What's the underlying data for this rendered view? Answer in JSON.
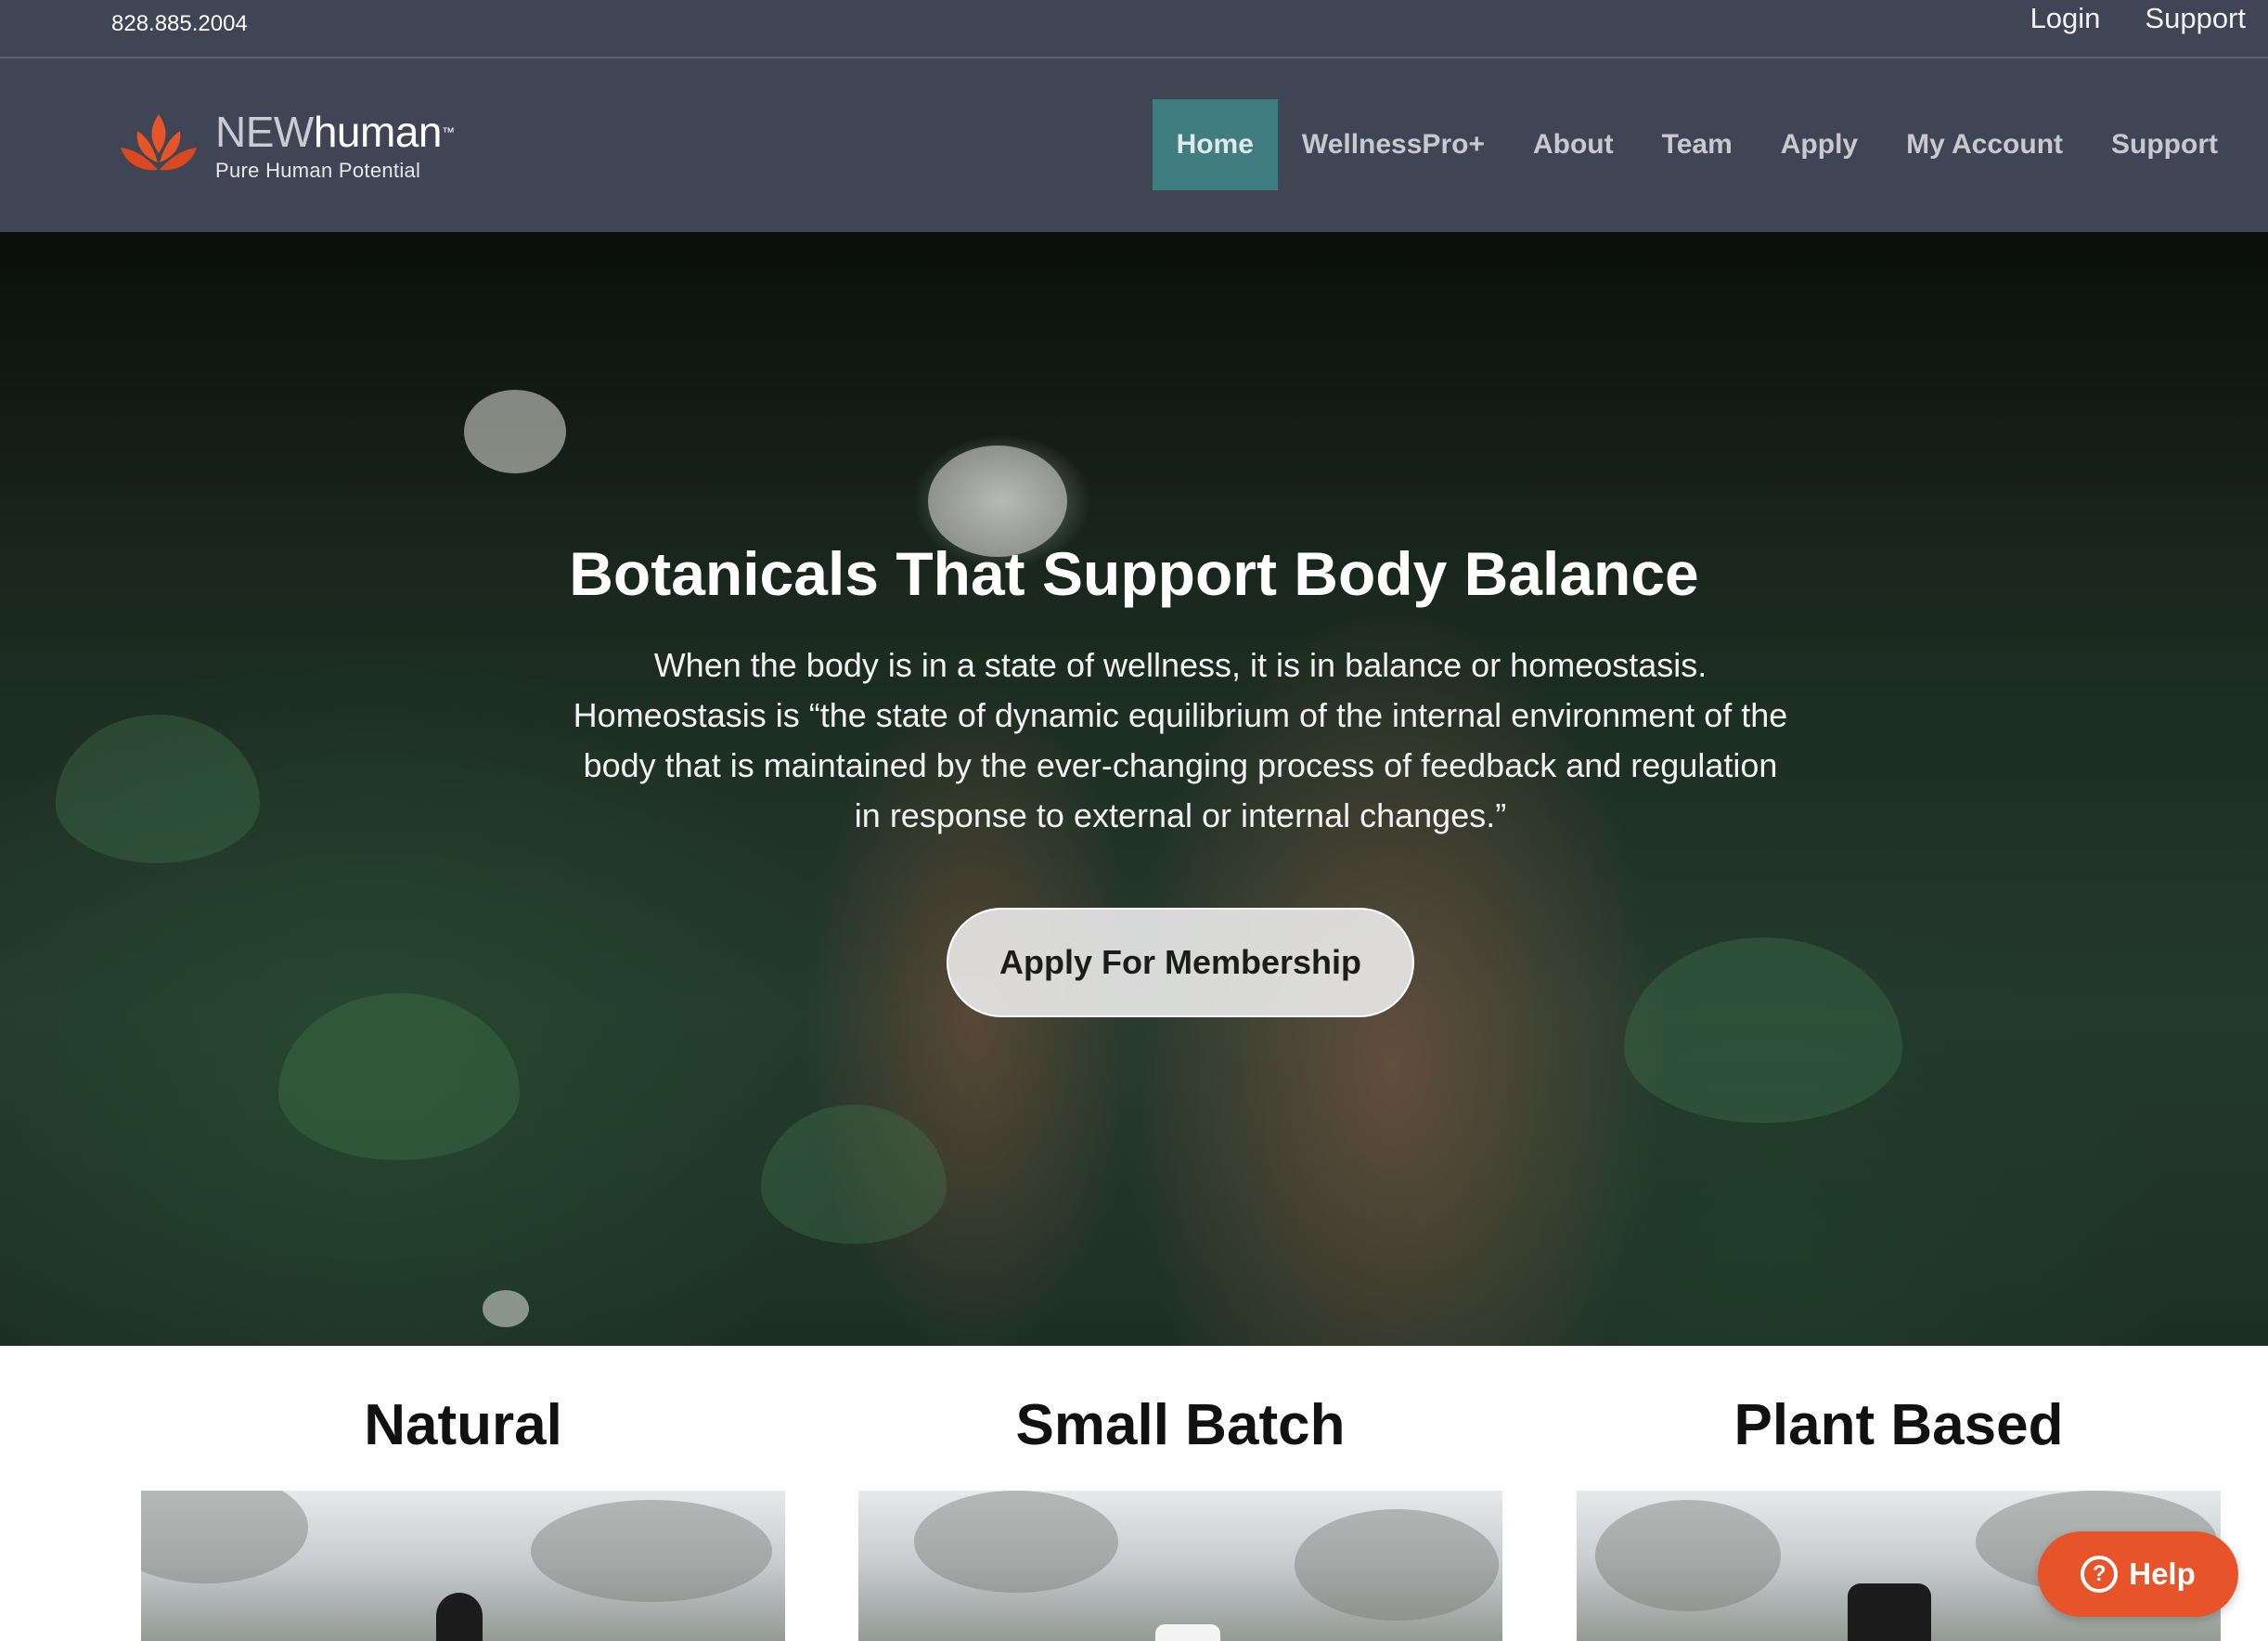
{
  "topbar": {
    "phone": "828.885.2004",
    "login": "Login",
    "support": "Support"
  },
  "logo": {
    "brand_prefix": "NEW",
    "brand_suffix": "human",
    "trademark": "™",
    "tagline": "Pure Human Potential",
    "icon": "lotus-icon",
    "accent_color": "#e8542a"
  },
  "nav": {
    "items": [
      {
        "label": "Home",
        "active": true
      },
      {
        "label": "WellnessPro+"
      },
      {
        "label": "About"
      },
      {
        "label": "Team"
      },
      {
        "label": "Apply"
      },
      {
        "label": "My Account"
      },
      {
        "label": "Support"
      }
    ],
    "active_color": "#3f7d80"
  },
  "hero": {
    "title": "Botanicals That Support Body Balance",
    "description": "When the body is in a state of wellness, it is in balance or homeostasis. Homeostasis is “the state of dynamic equilibrium of the internal environment of the body that is maintained by the ever-changing process of feedback and regulation in response to external or internal changes.”",
    "cta": "Apply For Membership"
  },
  "features": [
    {
      "title": "Natural"
    },
    {
      "title": "Small Batch"
    },
    {
      "title": "Plant Based"
    }
  ],
  "help": {
    "label": "Help",
    "icon": "question-circle-icon",
    "color": "#e8542a"
  },
  "colors": {
    "header_bg": "#3f4554"
  }
}
